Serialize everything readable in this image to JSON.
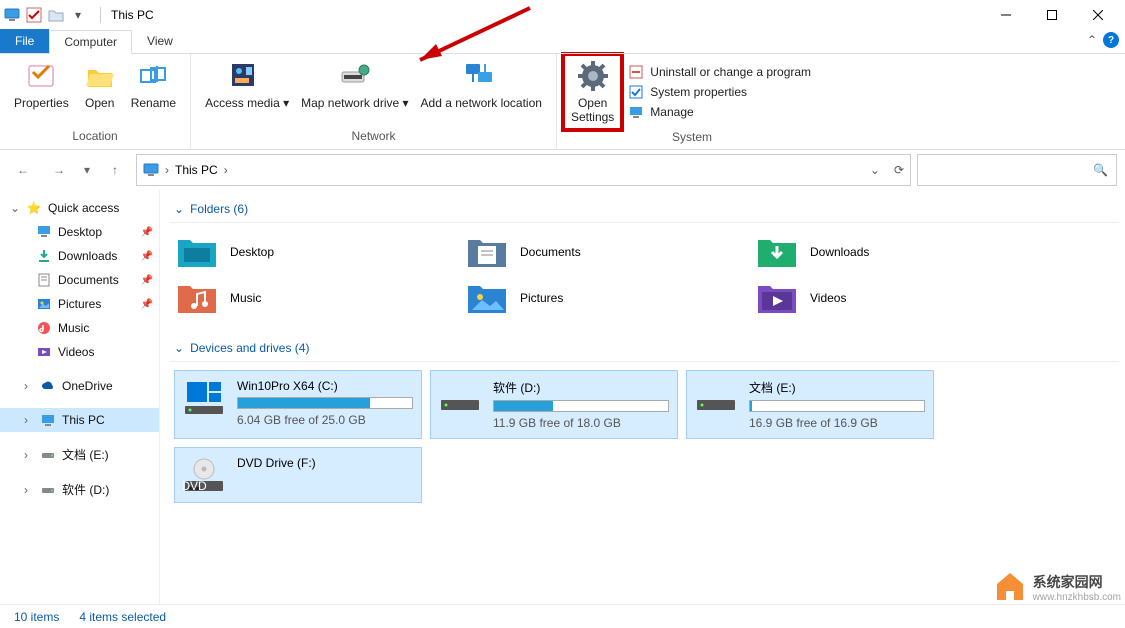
{
  "title": "This PC",
  "tabs": {
    "file": "File",
    "computer": "Computer",
    "view": "View"
  },
  "ribbon": {
    "location": {
      "properties": "Properties",
      "open": "Open",
      "rename": "Rename",
      "label": "Location"
    },
    "network": {
      "access": "Access media",
      "map": "Map network drive",
      "add": "Add a network location",
      "label": "Network"
    },
    "open_settings": {
      "line1": "Open",
      "line2": "Settings"
    },
    "system": {
      "uninstall": "Uninstall or change a program",
      "props": "System properties",
      "manage": "Manage",
      "label": "System"
    }
  },
  "breadcrumb": {
    "root": "This PC"
  },
  "sidebar": {
    "quick": "Quick access",
    "desktop": "Desktop",
    "downloads": "Downloads",
    "documents": "Documents",
    "pictures": "Pictures",
    "music": "Music",
    "videos": "Videos",
    "onedrive": "OneDrive",
    "thispc": "This PC",
    "drive_e": "文档 (E:)",
    "drive_d": "软件 (D:)"
  },
  "sections": {
    "folders": "Folders (6)",
    "drives": "Devices and drives (4)"
  },
  "folders": {
    "desktop": "Desktop",
    "documents": "Documents",
    "downloads": "Downloads",
    "music": "Music",
    "pictures": "Pictures",
    "videos": "Videos"
  },
  "drives": {
    "c": {
      "name": "Win10Pro X64 (C:)",
      "free": "6.04 GB free of 25.0 GB",
      "pct": 76
    },
    "d": {
      "name": "软件 (D:)",
      "free": "11.9 GB free of 18.0 GB",
      "pct": 34
    },
    "e": {
      "name": "文档 (E:)",
      "free": "16.9 GB free of 16.9 GB",
      "pct": 1
    },
    "f": {
      "name": "DVD Drive (F:)"
    }
  },
  "status": {
    "items": "10 items",
    "selected": "4 items selected"
  },
  "watermark": {
    "brand": "系统家园网",
    "url": "www.hnzkhbsb.com"
  }
}
